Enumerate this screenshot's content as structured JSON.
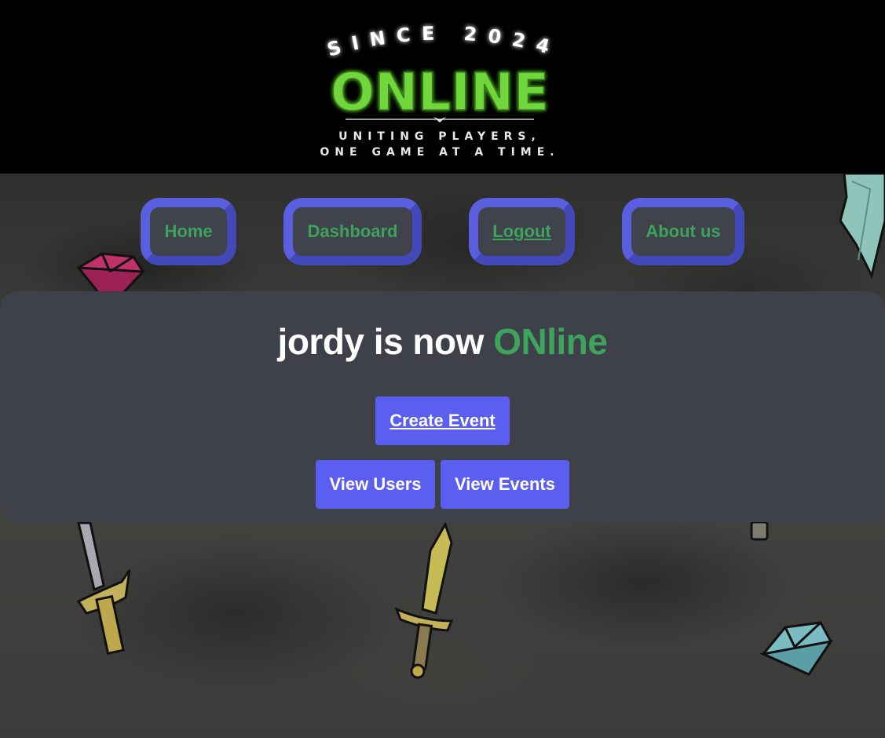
{
  "header": {
    "logo": {
      "arc_text": "SINCE 2024",
      "wordmark": "ONLINE",
      "tagline_line1": "UNITING PLAYERS,",
      "tagline_line2": "ONE GAME AT A TIME."
    }
  },
  "nav": {
    "items": [
      {
        "label": "Home"
      },
      {
        "label": "Dashboard"
      },
      {
        "label": "Logout"
      },
      {
        "label": "About us"
      }
    ]
  },
  "main": {
    "welcome_prefix": "jordy is now ",
    "welcome_accent": "ONline",
    "buttons": {
      "create_event": "Create Event",
      "view_users": "View Users",
      "view_events": "View Events"
    }
  },
  "colors": {
    "accent_green": "#3da35d",
    "button_blue": "#5a5ff0",
    "card": "#3f414a",
    "logo_green": "#6fd63a"
  }
}
